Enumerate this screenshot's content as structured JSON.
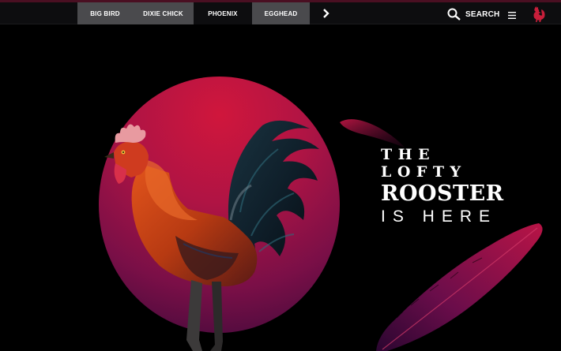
{
  "nav": {
    "tabs": [
      {
        "label": "BIG BIRD",
        "active": false
      },
      {
        "label": "DIXIE CHICK",
        "active": false
      },
      {
        "label": "PHOENIX",
        "active": true
      },
      {
        "label": "EGGHEAD",
        "active": false
      }
    ],
    "next_icon": "chevron-right-icon",
    "search_label": "SEARCH",
    "search_icon": "search-icon",
    "menu_icon": "hamburger-menu-icon",
    "logo_icon": "rooster-logo-icon"
  },
  "hero": {
    "line1": "THE LOFTY",
    "line2": "ROOSTER",
    "line3": "IS HERE",
    "image": "rooster-image",
    "accent_color": "#c8163e",
    "feathers": [
      "feather-small",
      "feather-large"
    ]
  }
}
